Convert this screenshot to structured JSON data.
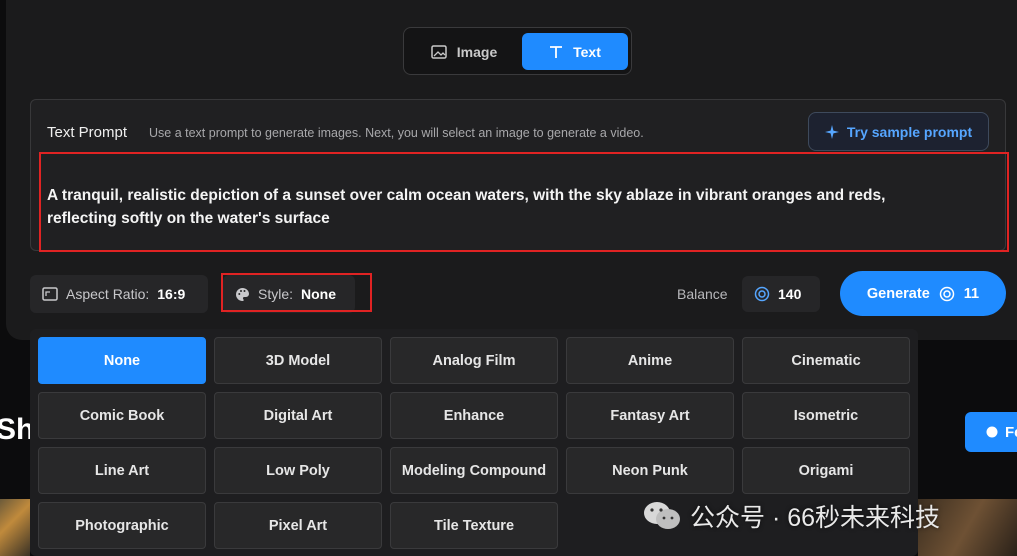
{
  "mode_toggle": {
    "image_label": "Image",
    "text_label": "Text",
    "selected": "Text"
  },
  "prompt": {
    "title": "Text Prompt",
    "hint": "Use a text prompt to generate images. Next, you will select an image to generate a video.",
    "sample_button": "Try sample prompt",
    "value": "A tranquil, realistic depiction of a sunset over calm ocean waters, with the sky ablaze in vibrant oranges and reds, reflecting softly on the water's surface"
  },
  "controls": {
    "aspect_label": "Aspect Ratio:",
    "aspect_value": "16:9",
    "style_label": "Style:",
    "style_value": "None",
    "balance_label": "Balance",
    "balance_value": "140",
    "generate_label": "Generate",
    "generate_cost": "11"
  },
  "styles": [
    "None",
    "3D Model",
    "Analog Film",
    "Anime",
    "Cinematic",
    "Comic Book",
    "Digital Art",
    "Enhance",
    "Fantasy Art",
    "Isometric",
    "Line Art",
    "Low Poly",
    "Modeling Compound",
    "Neon Punk",
    "Origami",
    "Photographic",
    "Pixel Art",
    "Tile Texture"
  ],
  "selected_style": "None",
  "background": {
    "title_fragment": "Sh",
    "button_fragment": "Fe"
  },
  "watermark": "公众号 · 66秒未来科技",
  "colors": {
    "accent": "#1f8bff",
    "highlight": "#e02323"
  },
  "icons": [
    "image-icon",
    "text-icon",
    "sparkle-icon",
    "aspect-icon",
    "palette-icon",
    "credit-icon",
    "wechat-icon"
  ]
}
